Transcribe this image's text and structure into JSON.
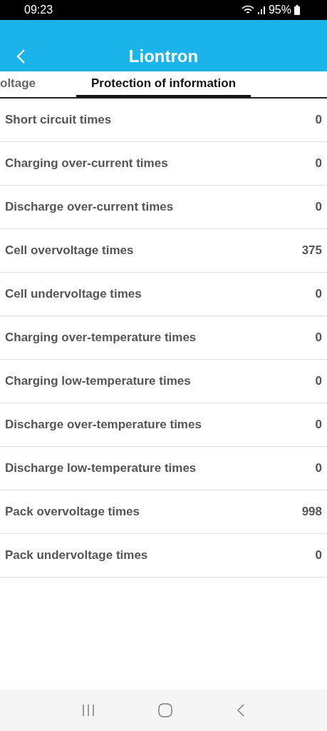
{
  "status_bar": {
    "time": "09:23",
    "battery": "95%"
  },
  "header": {
    "title": "Liontron"
  },
  "tabs": [
    {
      "label": "oltage",
      "selected": false
    },
    {
      "label": "Protection of information",
      "selected": true
    }
  ],
  "rows": [
    {
      "label": "Short circuit times",
      "value": "0"
    },
    {
      "label": "Charging over-current times",
      "value": "0"
    },
    {
      "label": "Discharge over-current times",
      "value": "0"
    },
    {
      "label": "Cell overvoltage times",
      "value": "375"
    },
    {
      "label": "Cell undervoltage times",
      "value": "0"
    },
    {
      "label": "Charging over-temperature times",
      "value": "0"
    },
    {
      "label": "Charging low-temperature times",
      "value": "0"
    },
    {
      "label": "Discharge over-temperature times",
      "value": "0"
    },
    {
      "label": "Discharge low-temperature times",
      "value": "0"
    },
    {
      "label": "Pack overvoltage times",
      "value": "998"
    },
    {
      "label": "Pack undervoltage times",
      "value": "0"
    }
  ]
}
